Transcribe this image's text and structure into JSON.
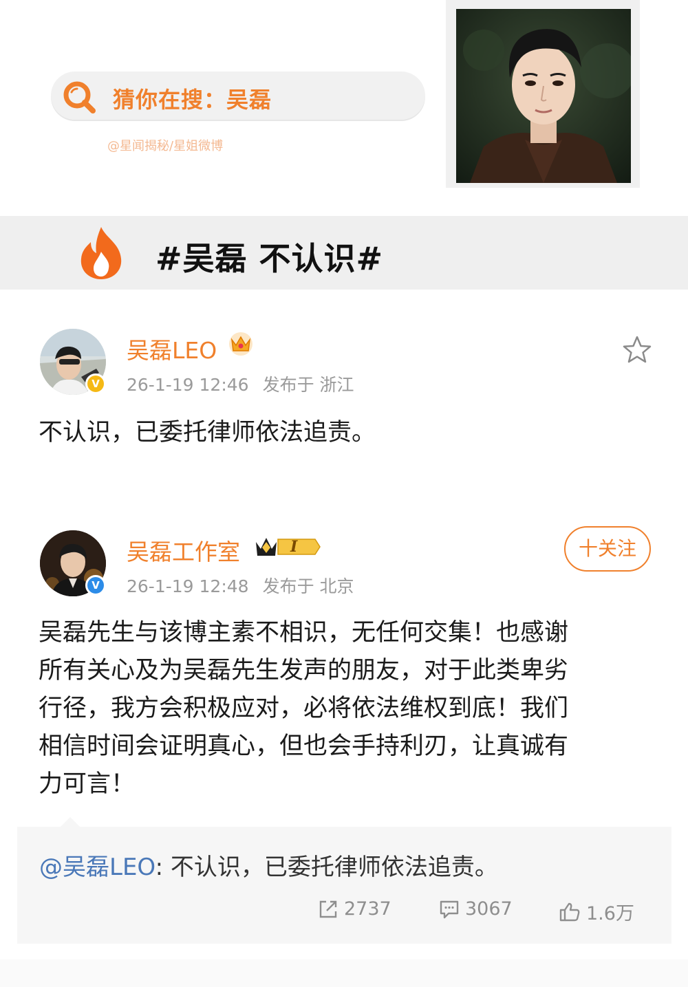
{
  "banner": {
    "search_text": "猜你在搜：吴磊",
    "credit": "@星闻揭秘/星姐微博"
  },
  "topic": {
    "text": "#吴磊 不认识#"
  },
  "post1": {
    "username": "吴磊LEO",
    "time": "26-1-19 12:46",
    "location": "发布于 浙江",
    "content": "不认识，已委托律师依法追责。"
  },
  "post2": {
    "username": "吴磊工作室",
    "rank_badge": "I",
    "time": "26-1-19 12:48",
    "location": "发布于 北京",
    "follow_label": "十关注",
    "content_lines": [
      "吴磊先生与该博主素不相识，无任何交集！也感谢",
      "所有关心及为吴磊先生发声的朋友，对于此类卑劣",
      "行径，我方会积极应对，必将依法维权到底！我们",
      "相信时间会证明真心，但也会手持利刃，让真诚有",
      "力可言！"
    ]
  },
  "quote": {
    "mention": "@吴磊LEO",
    "text": ": 不认识，已委托律师依法追责。",
    "reposts": "2737",
    "comments": "3067",
    "likes": "1.6万"
  },
  "colors": {
    "accent_orange": "#f0802c",
    "mention_blue": "#4a78b8",
    "verified_blue": "#2c8ce8",
    "vip_gold": "#f5b915"
  },
  "icons": [
    "search-icon",
    "fire-icon",
    "crown-icon",
    "star-icon",
    "repost-icon",
    "comment-icon",
    "like-icon"
  ]
}
